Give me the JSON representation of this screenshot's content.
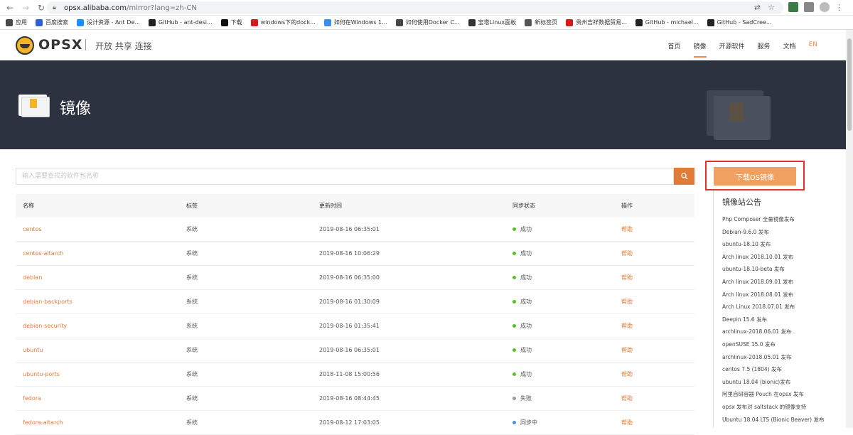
{
  "browser": {
    "url_host": "opsx.alibaba.com",
    "url_path": "/mirror?lang=zh-CN",
    "bookmarks": [
      {
        "label": "应用",
        "color": "#4a4a4a"
      },
      {
        "label": "百度搜索",
        "color": "#2d5fd8"
      },
      {
        "label": "设计资源 - Ant De...",
        "color": "#1890ff"
      },
      {
        "label": "GitHub - ant-desi...",
        "color": "#222222"
      },
      {
        "label": "下载",
        "color": "#111111"
      },
      {
        "label": "windows下的dock...",
        "color": "#d71a1a"
      },
      {
        "label": "如何在Windows 1...",
        "color": "#3a8ee6"
      },
      {
        "label": "如何使用Docker C...",
        "color": "#444444"
      },
      {
        "label": "宝塔Linux面板",
        "color": "#333333"
      },
      {
        "label": "新标签页",
        "color": "#555555"
      },
      {
        "label": "贵州吉祥数据贸易...",
        "color": "#d71a1a"
      },
      {
        "label": "GitHub - michael...",
        "color": "#222222"
      },
      {
        "label": "GitHub - SadCree...",
        "color": "#222222"
      }
    ]
  },
  "header": {
    "brand": "OPSX",
    "tagline": "开放 共享 连接",
    "nav": [
      "首页",
      "镜像",
      "开源软件",
      "服务",
      "文档",
      "EN"
    ]
  },
  "banner": {
    "title": "镜像"
  },
  "search": {
    "placeholder": "输入需要查找的软件包名称"
  },
  "table": {
    "headers": [
      "名称",
      "标签",
      "更新时间",
      "同步状态",
      "操作"
    ],
    "rows": [
      {
        "name": "centos",
        "tag": "系统",
        "time": "2019-08-16 06:35:01",
        "status": "成功",
        "status_color": "#52c41a",
        "action": "帮助"
      },
      {
        "name": "centos-altarch",
        "tag": "系统",
        "time": "2019-08-16 10:06:29",
        "status": "成功",
        "status_color": "#52c41a",
        "action": "帮助"
      },
      {
        "name": "debian",
        "tag": "系统",
        "time": "2019-08-16 06:35:00",
        "status": "成功",
        "status_color": "#52c41a",
        "action": "帮助"
      },
      {
        "name": "debian-backports",
        "tag": "系统",
        "time": "2019-08-16 01:30:09",
        "status": "成功",
        "status_color": "#52c41a",
        "action": "帮助"
      },
      {
        "name": "debian-security",
        "tag": "系统",
        "time": "2019-08-16 01:35:41",
        "status": "成功",
        "status_color": "#52c41a",
        "action": "帮助"
      },
      {
        "name": "ubuntu",
        "tag": "系统",
        "time": "2019-08-16 06:35:01",
        "status": "成功",
        "status_color": "#52c41a",
        "action": "帮助"
      },
      {
        "name": "ubuntu-ports",
        "tag": "系统",
        "time": "2018-11-08 15:00:56",
        "status": "成功",
        "status_color": "#52c41a",
        "action": "帮助"
      },
      {
        "name": "fedora",
        "tag": "系统",
        "time": "2019-08-16 08:44:45",
        "status": "失败",
        "status_color": "#999999",
        "action": "帮助"
      },
      {
        "name": "fedora-altarch",
        "tag": "系统",
        "time": "2019-08-12 17:03:05",
        "status": "同步中",
        "status_color": "#4a90e2",
        "action": "帮助"
      }
    ]
  },
  "sidebar": {
    "download_label": "下载OS镜像",
    "notice_title": "镜像站公告",
    "notices": [
      "Php Composer 全量镜像发布",
      "Debian-9.6.0 发布",
      "ubuntu-18.10 发布",
      "Arch linux 2018.10.01 发布",
      "ubuntu-18.10-beta 发布",
      "Arch linux 2018.09.01 发布",
      "Arch linux 2018.08.01 发布",
      "Arch Linux 2018.07.01 发布",
      "Deepin 15.6 发布",
      "archlinux-2018.06.01 发布",
      "openSUSE 15.0 发布",
      "archlinux-2018.05.01 发布",
      "centos 7.5 (1804) 发布",
      "ubuntu 18.04 (bionic)发布",
      "阿里自研容器 Pouch 在opsx 发布",
      "opsx 发布对 saltstack 的镜像支持",
      "Ubuntu 18.04 LTS (Bionic Beaver) 发布"
    ]
  },
  "colors": {
    "accent": "#e07b39",
    "banner_bg": "#2c3240",
    "highlight_border": "#e5312d"
  }
}
